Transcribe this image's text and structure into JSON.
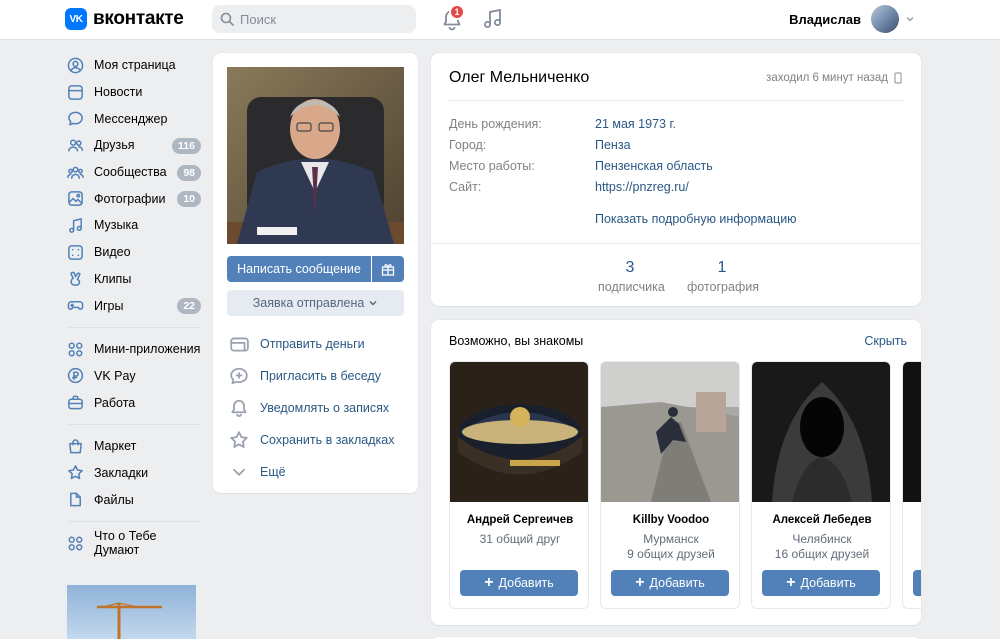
{
  "header": {
    "logo_mark": "VK",
    "logo_text": "вконтакте",
    "search_placeholder": "Поиск",
    "notifications_count": "1",
    "user_name": "Владислав"
  },
  "sidebar": {
    "items": [
      {
        "label": "Моя страница",
        "icon": "user-circle-icon"
      },
      {
        "label": "Новости",
        "icon": "news-icon"
      },
      {
        "label": "Мессенджер",
        "icon": "message-icon"
      },
      {
        "label": "Друзья",
        "icon": "friends-icon",
        "count": "116"
      },
      {
        "label": "Сообщества",
        "icon": "communities-icon",
        "count": "98"
      },
      {
        "label": "Фотографии",
        "icon": "photo-icon",
        "count": "10"
      },
      {
        "label": "Музыка",
        "icon": "music-icon"
      },
      {
        "label": "Видео",
        "icon": "video-icon"
      },
      {
        "label": "Клипы",
        "icon": "clips-icon"
      },
      {
        "label": "Игры",
        "icon": "games-icon",
        "count": "22"
      }
    ],
    "items2": [
      {
        "label": "Мини-приложения",
        "icon": "apps-icon"
      },
      {
        "label": "VK Pay",
        "icon": "vkpay-icon"
      },
      {
        "label": "Работа",
        "icon": "briefcase-icon"
      }
    ],
    "items3": [
      {
        "label": "Маркет",
        "icon": "market-icon"
      },
      {
        "label": "Закладки",
        "icon": "star-icon"
      },
      {
        "label": "Файлы",
        "icon": "file-icon"
      }
    ],
    "items4": [
      {
        "label": "Что о Тебе Думают",
        "icon": "apps-icon"
      }
    ]
  },
  "profile": {
    "send_message": "Написать сообщение",
    "request_sent": "Заявка отправлена",
    "actions": [
      {
        "label": "Отправить деньги",
        "icon": "money-icon"
      },
      {
        "label": "Пригласить в беседу",
        "icon": "chat-add-icon"
      },
      {
        "label": "Уведомлять о записях",
        "icon": "bell-icon"
      },
      {
        "label": "Сохранить в закладках",
        "icon": "star-icon"
      },
      {
        "label": "Ещё",
        "icon": "chevron-down-icon"
      }
    ]
  },
  "info": {
    "name": "Олег Мельниченко",
    "last_seen": "заходил 6 минут назад",
    "rows": [
      {
        "label": "День рождения:",
        "value": "21 мая 1973 г."
      },
      {
        "label": "Город:",
        "value": "Пенза"
      },
      {
        "label": "Место работы:",
        "value": "Пензенская область"
      },
      {
        "label": "Сайт:",
        "value": "https://pnzreg.ru/"
      }
    ],
    "show_more": "Показать подробную информацию",
    "counters": [
      {
        "num": "3",
        "label": "подписчика"
      },
      {
        "num": "1",
        "label": "фотография"
      }
    ]
  },
  "suggestions": {
    "title": "Возможно, вы знакомы",
    "hide": "Скрыть",
    "add_label": "Добавить",
    "people": [
      {
        "name": "Андрей Сергеичев",
        "line1": "31 общий друг",
        "line2": ""
      },
      {
        "name": "Killby Voodoo",
        "line1": "Мурманск",
        "line2": "9 общих друзей"
      },
      {
        "name": "Алексей Лебедев",
        "line1": "Челябинск",
        "line2": "16 общих друзей"
      }
    ]
  }
}
